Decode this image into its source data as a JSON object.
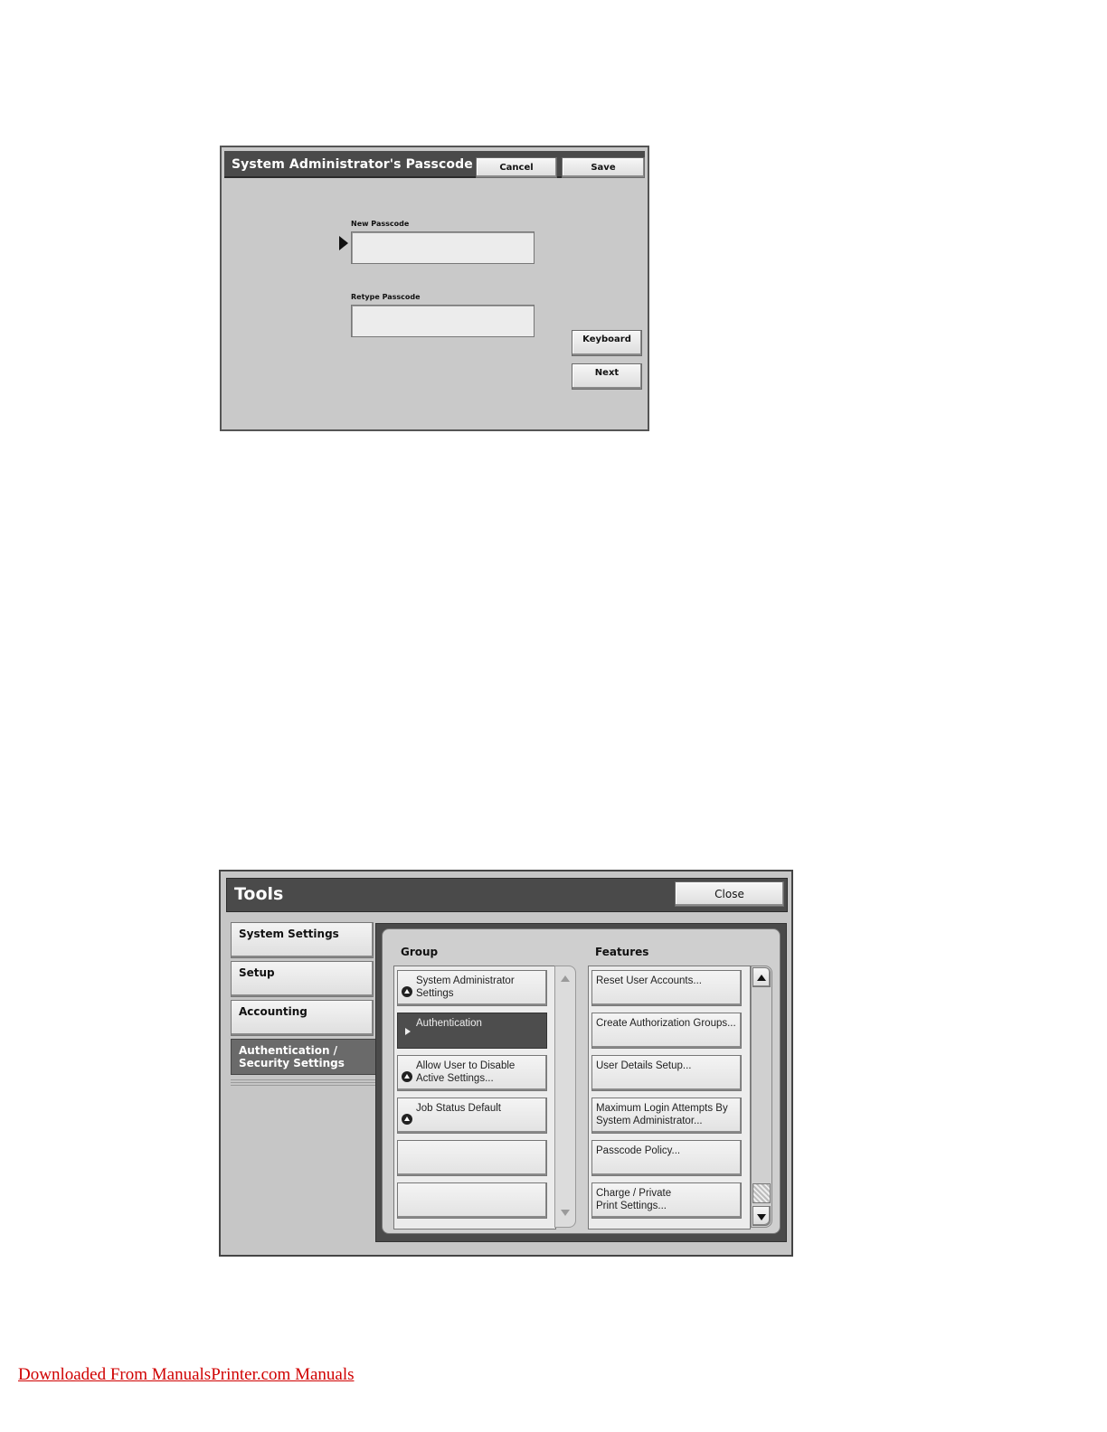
{
  "passcode_screen": {
    "title": "System Administrator's Passcode",
    "cancel_label": "Cancel",
    "save_label": "Save",
    "new_passcode_label": "New Passcode",
    "new_passcode_value": "",
    "retype_passcode_label": "Retype Passcode",
    "retype_passcode_value": "",
    "keyboard_label": "Keyboard",
    "next_label": "Next"
  },
  "tools_screen": {
    "title": "Tools",
    "close_label": "Close",
    "tabs": [
      {
        "label": "System Settings"
      },
      {
        "label": "Setup"
      },
      {
        "label": "Accounting"
      },
      {
        "label": "Authentication / Security Settings",
        "line1": "Authentication /",
        "line2": "Security Settings",
        "selected": true
      }
    ],
    "group_heading": "Group",
    "features_heading": "Features",
    "group_items": [
      {
        "line1": "System Administrator",
        "line2": "Settings"
      },
      {
        "line1": "Authentication",
        "line2": "",
        "selected": true
      },
      {
        "line1": "Allow User to Disable",
        "line2": "Active Settings..."
      },
      {
        "line1": "Job Status Default",
        "line2": ""
      },
      {
        "line1": "",
        "line2": ""
      },
      {
        "line1": "",
        "line2": ""
      }
    ],
    "feature_items": [
      {
        "line1": "Reset User Accounts...",
        "line2": ""
      },
      {
        "line1": "Create Authorization Groups...",
        "line2": ""
      },
      {
        "line1": "User Details Setup...",
        "line2": ""
      },
      {
        "line1": "Maximum Login Attempts By",
        "line2": "System Administrator..."
      },
      {
        "line1": "Passcode Policy...",
        "line2": ""
      },
      {
        "line1": "Charge / Private",
        "line2": "Print Settings..."
      }
    ]
  },
  "footer": {
    "link_text": "Downloaded From ManualsPrinter.com Manuals"
  }
}
